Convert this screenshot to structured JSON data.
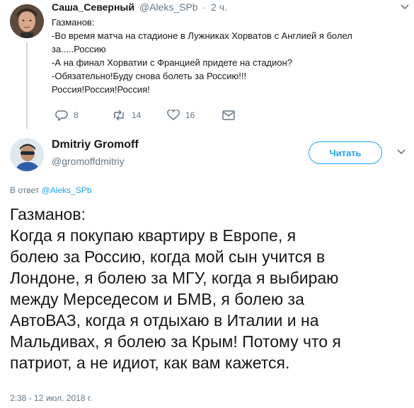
{
  "parent_tweet": {
    "author_name": "Саша_Северный",
    "handle": "@Aleks_SPb",
    "separator": "·",
    "time": "2 ч.",
    "text_lines": [
      "Газманов:",
      "-Во время матча на стадионе в Лужниках Хорватов с Англией я болел",
      "за.....Россию",
      "-А на финал Хорватии с Францией придете на стадион?",
      "-Обязательно!Буду снова болеть за Россию!!!",
      "Россия!Россия!Россия!"
    ],
    "actions": {
      "reply_icon": "reply-icon",
      "reply_count": "8",
      "retweet_icon": "retweet-icon",
      "retweet_count": "14",
      "like_icon": "heart-icon",
      "like_count": "16",
      "dm_icon": "envelope-icon"
    }
  },
  "main_tweet": {
    "author_name": "Dmitriy Gromoff",
    "handle": "@gromoffdmitriy",
    "follow_label": "Читать",
    "reply_prefix": "В ответ",
    "reply_handle": "@Aleks_SPb",
    "text_lines": [
      "Газманов:",
      "Когда я покупаю квартиру в Европе, я",
      "болею за Россию, когда мой сын учится в",
      "Лондоне, я болею за МГУ, когда я выбираю",
      "между Мерседесом и БМВ, я болею за",
      "АвтоВАЗ, когда я отдыхаю в Италии и на",
      "Мальдивах, я болею за Крым! Потому что я",
      "патриот, а не идиот, как вам кажется."
    ],
    "timestamp": "2:38 - 12 июл. 2018 г."
  },
  "colors": {
    "accent": "#1da1f2",
    "secondary_text": "#657786",
    "primary_text": "#14171a"
  }
}
